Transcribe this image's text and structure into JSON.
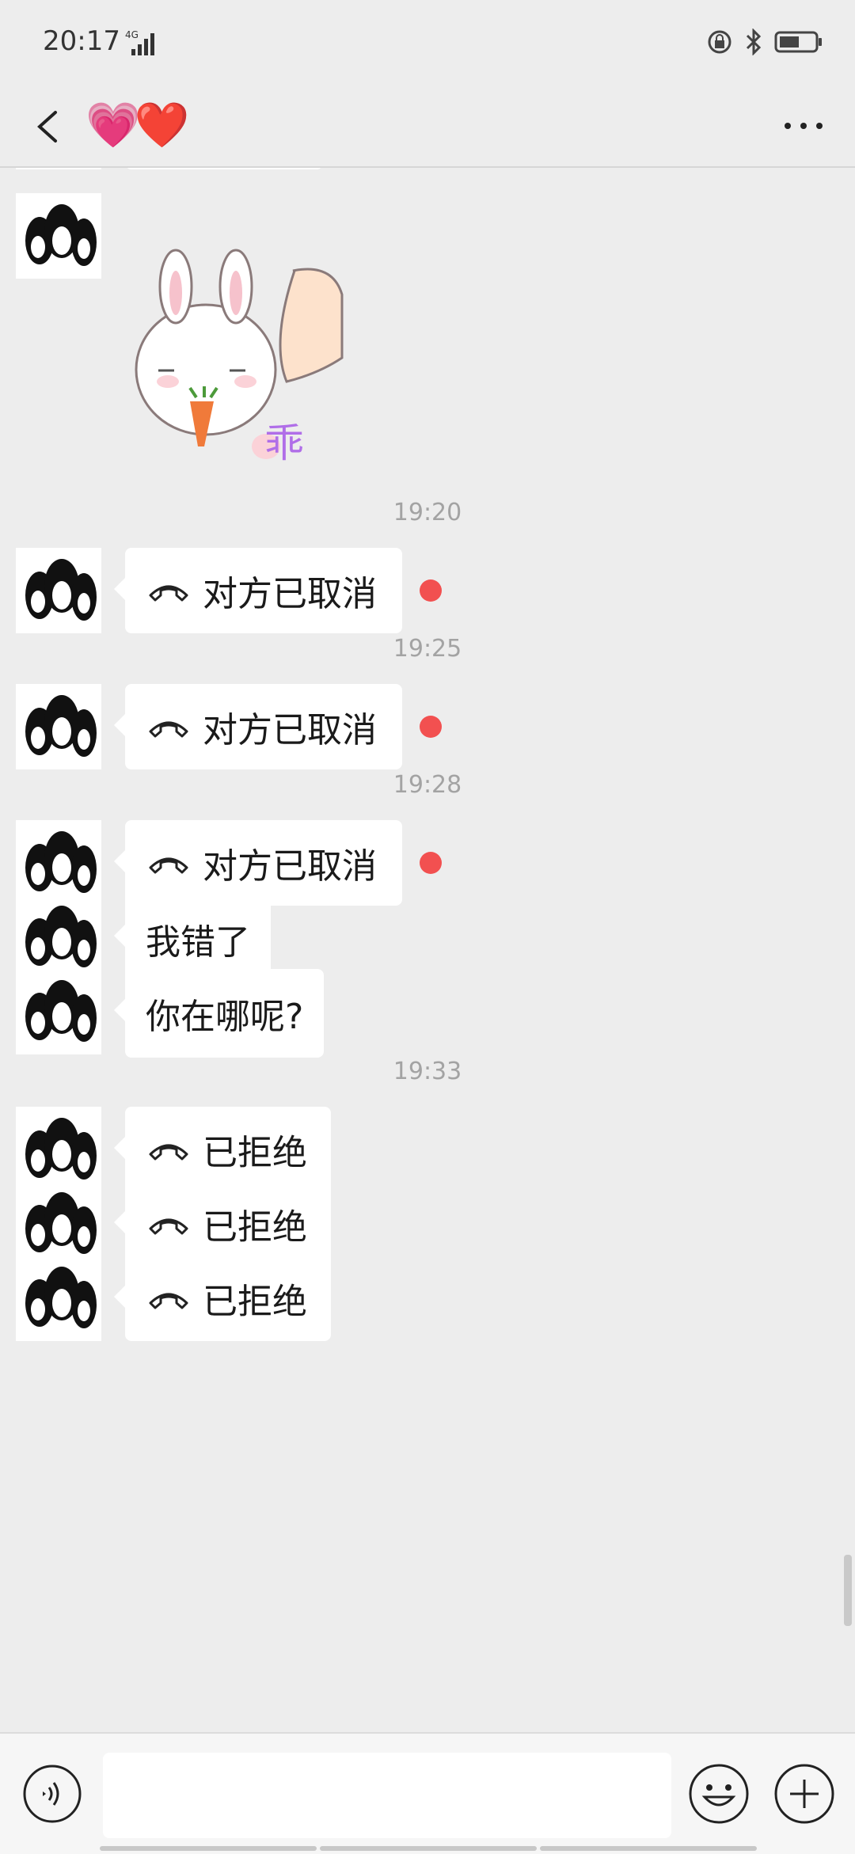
{
  "status_bar": {
    "time": "20:17",
    "network": "4G"
  },
  "header": {
    "title": "💗❤️"
  },
  "messages": [
    {
      "type": "call",
      "text": "对方已取消",
      "time": "19:20",
      "unread": true
    },
    {
      "type": "call",
      "text": "对方已取消",
      "time": "19:25",
      "unread": true
    },
    {
      "type": "call",
      "text": "对方已取消",
      "time": "19:28",
      "unread": true
    },
    {
      "type": "text",
      "text": "我错了"
    },
    {
      "type": "text",
      "text": "你在哪呢?"
    },
    {
      "type": "call",
      "text": "已拒绝",
      "time": "19:33"
    },
    {
      "type": "call",
      "text": "已拒绝"
    },
    {
      "type": "call",
      "text": "已拒绝"
    }
  ],
  "sticker": {
    "caption": "乖"
  },
  "input": {
    "placeholder": ""
  },
  "colors": {
    "background": "#ededed",
    "bubble": "#ffffff",
    "unread_dot": "#f25050",
    "timestamp": "#a3a3a3"
  }
}
